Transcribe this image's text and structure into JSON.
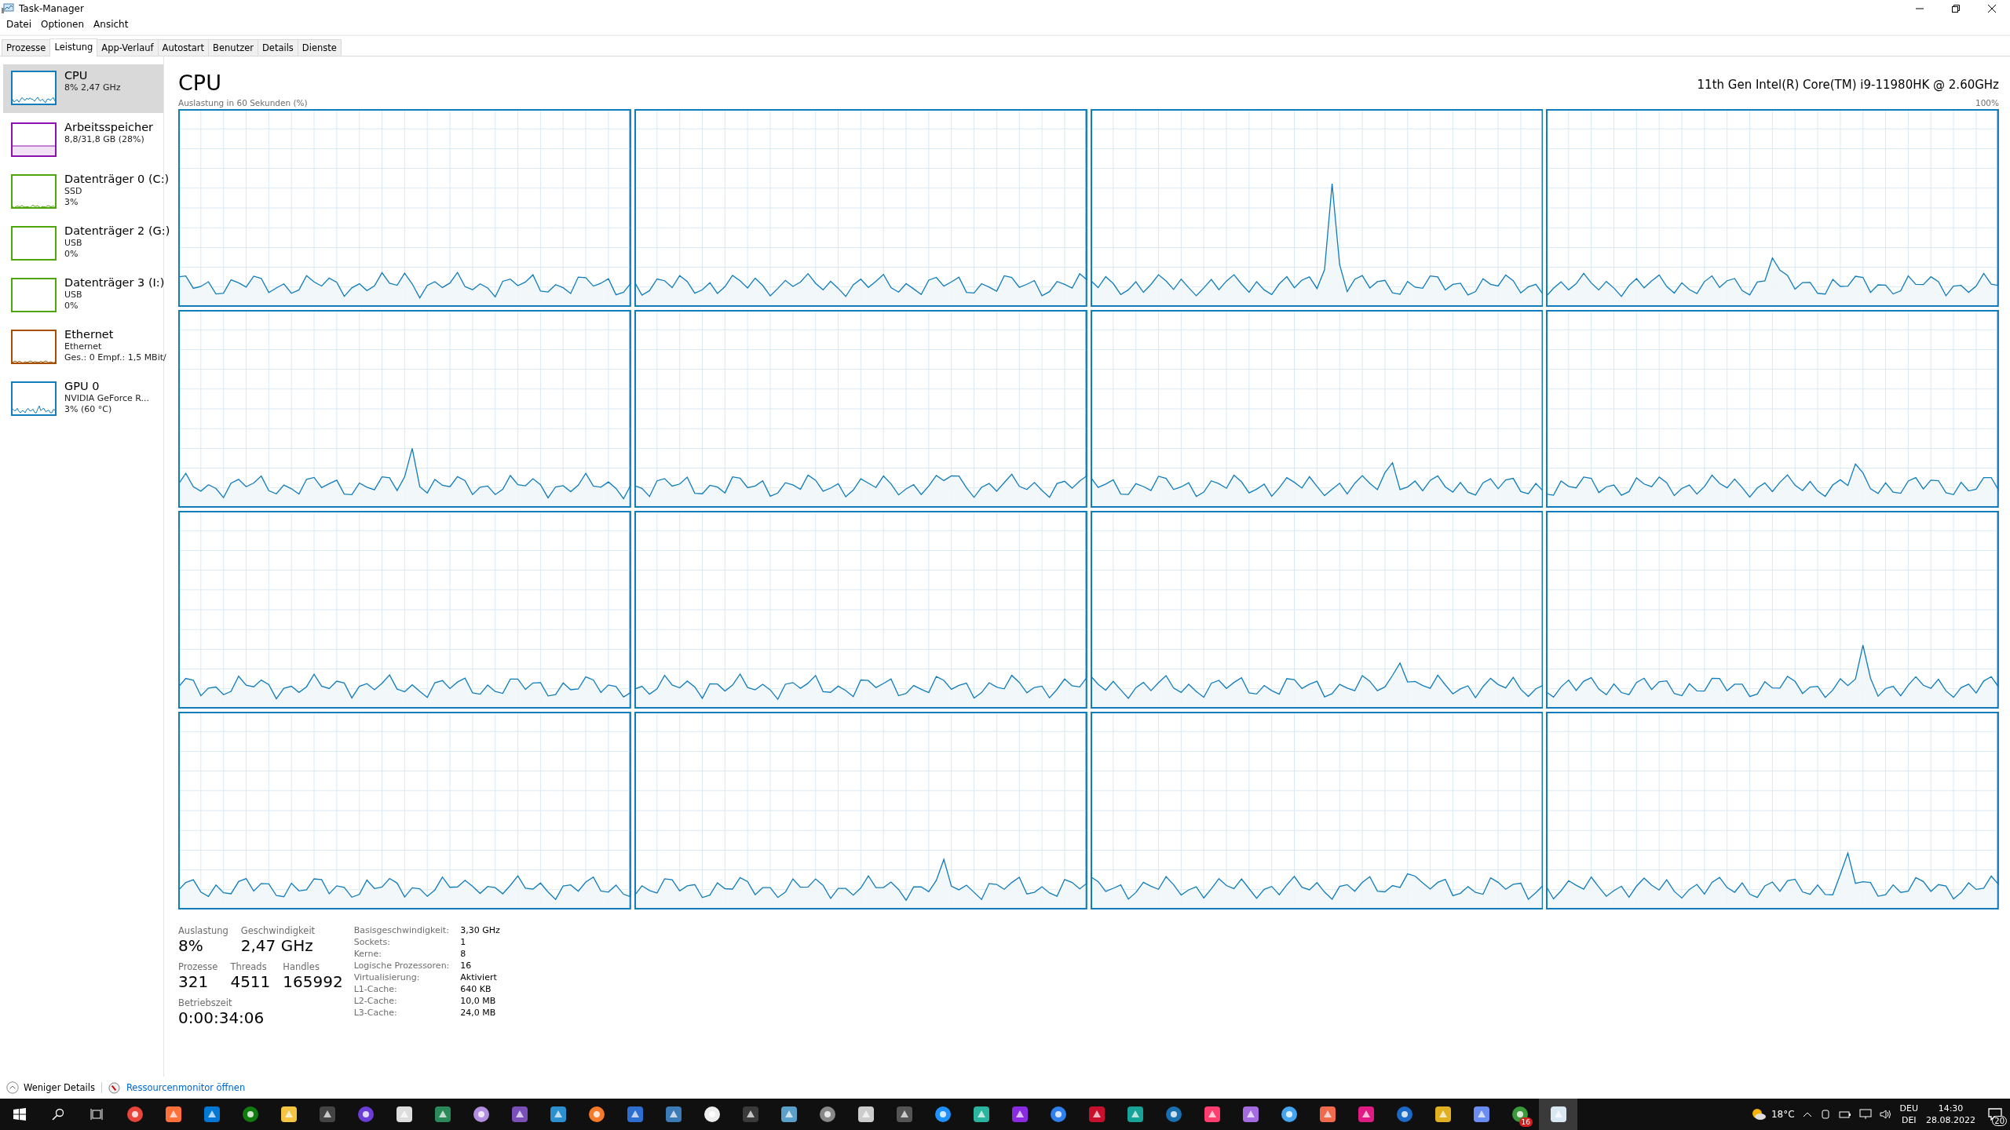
{
  "window": {
    "title": "Task-Manager"
  },
  "menu": [
    "Datei",
    "Optionen",
    "Ansicht"
  ],
  "tabs": [
    {
      "label": "Prozesse",
      "selected": false
    },
    {
      "label": "Leistung",
      "selected": true
    },
    {
      "label": "App-Verlauf",
      "selected": false
    },
    {
      "label": "Autostart",
      "selected": false
    },
    {
      "label": "Benutzer",
      "selected": false
    },
    {
      "label": "Details",
      "selected": false
    },
    {
      "label": "Dienste",
      "selected": false
    }
  ],
  "sidebar": {
    "items": [
      {
        "title": "CPU",
        "lines": [
          "8% 2,47 GHz"
        ],
        "color": "#117dbb",
        "selected": true
      },
      {
        "title": "Arbeitsspeicher",
        "lines": [
          "8,8/31,8 GB (28%)"
        ],
        "color": "#8b12ae",
        "selected": false
      },
      {
        "title": "Datenträger 0 (C:)",
        "lines": [
          "SSD",
          "3%"
        ],
        "color": "#4da60c",
        "selected": false
      },
      {
        "title": "Datenträger 2 (G:)",
        "lines": [
          "USB",
          "0%"
        ],
        "color": "#4da60c",
        "selected": false
      },
      {
        "title": "Datenträger 3 (I:)",
        "lines": [
          "USB",
          "0%"
        ],
        "color": "#4da60c",
        "selected": false
      },
      {
        "title": "Ethernet",
        "lines": [
          "Ethernet",
          "Ges.: 0 Empf.: 1,5 MBit/"
        ],
        "color": "#a74f01",
        "selected": false
      },
      {
        "title": "GPU 0",
        "lines": [
          "NVIDIA GeForce R...",
          "3% (60 °C)"
        ],
        "color": "#117dbb",
        "selected": false
      }
    ]
  },
  "header": {
    "title": "CPU",
    "processor": "11th Gen Intel(R) Core(TM) i9-11980HK @ 2.60GHz",
    "graph_caption": "Auslastung in 60 Sekunden (%)",
    "graph_max": "100%"
  },
  "stats": {
    "rows": [
      [
        {
          "label": "Auslastung",
          "value": "8%"
        },
        {
          "label": "Geschwindigkeit",
          "value": "2,47 GHz"
        }
      ],
      [
        {
          "label": "Prozesse",
          "value": "321"
        },
        {
          "label": "Threads",
          "value": "4511"
        },
        {
          "label": "Handles",
          "value": "165992"
        }
      ],
      [
        {
          "label": "Betriebszeit",
          "value": "0:00:34:06"
        }
      ]
    ],
    "details": [
      {
        "key": "Basisgeschwindigkeit:",
        "value": "3,30 GHz"
      },
      {
        "key": "Sockets:",
        "value": "1"
      },
      {
        "key": "Kerne:",
        "value": "8"
      },
      {
        "key": "Logische Prozessoren:",
        "value": "16"
      },
      {
        "key": "Virtualisierung:",
        "value": "Aktiviert"
      },
      {
        "key": "L1-Cache:",
        "value": "640 KB"
      },
      {
        "key": "L2-Cache:",
        "value": "10,0 MB"
      },
      {
        "key": "L3-Cache:",
        "value": "24,0 MB"
      }
    ]
  },
  "footer": {
    "less_details": "Weniger Details",
    "resource_monitor": "Ressourcenmonitor öffnen"
  },
  "taskbar": {
    "apps": [
      {
        "selected": false
      },
      {
        "selected": false
      },
      {
        "selected": false
      },
      {
        "selected": false
      },
      {
        "selected": false
      },
      {
        "selected": false
      },
      {
        "selected": false
      },
      {
        "selected": false
      },
      {
        "selected": false
      },
      {
        "selected": false
      },
      {
        "selected": false
      },
      {
        "selected": false
      },
      {
        "selected": false
      },
      {
        "selected": false
      },
      {
        "selected": false
      },
      {
        "selected": false
      },
      {
        "selected": false
      },
      {
        "selected": false
      },
      {
        "selected": false
      },
      {
        "selected": false
      },
      {
        "selected": false
      },
      {
        "selected": false
      },
      {
        "selected": false
      },
      {
        "selected": false
      },
      {
        "selected": false
      },
      {
        "selected": false
      },
      {
        "selected": false
      },
      {
        "selected": false
      },
      {
        "selected": false
      },
      {
        "selected": false
      },
      {
        "selected": false
      },
      {
        "selected": false
      },
      {
        "selected": false
      },
      {
        "selected": false
      },
      {
        "selected": false
      },
      {
        "selected": false
      },
      {
        "selected": false,
        "badge": "16"
      },
      {
        "selected": true
      }
    ],
    "weather": "18°C",
    "language": [
      "DEU",
      "DEI"
    ],
    "time": "14:30",
    "date": "28.08.2022",
    "notifications": "20"
  }
}
